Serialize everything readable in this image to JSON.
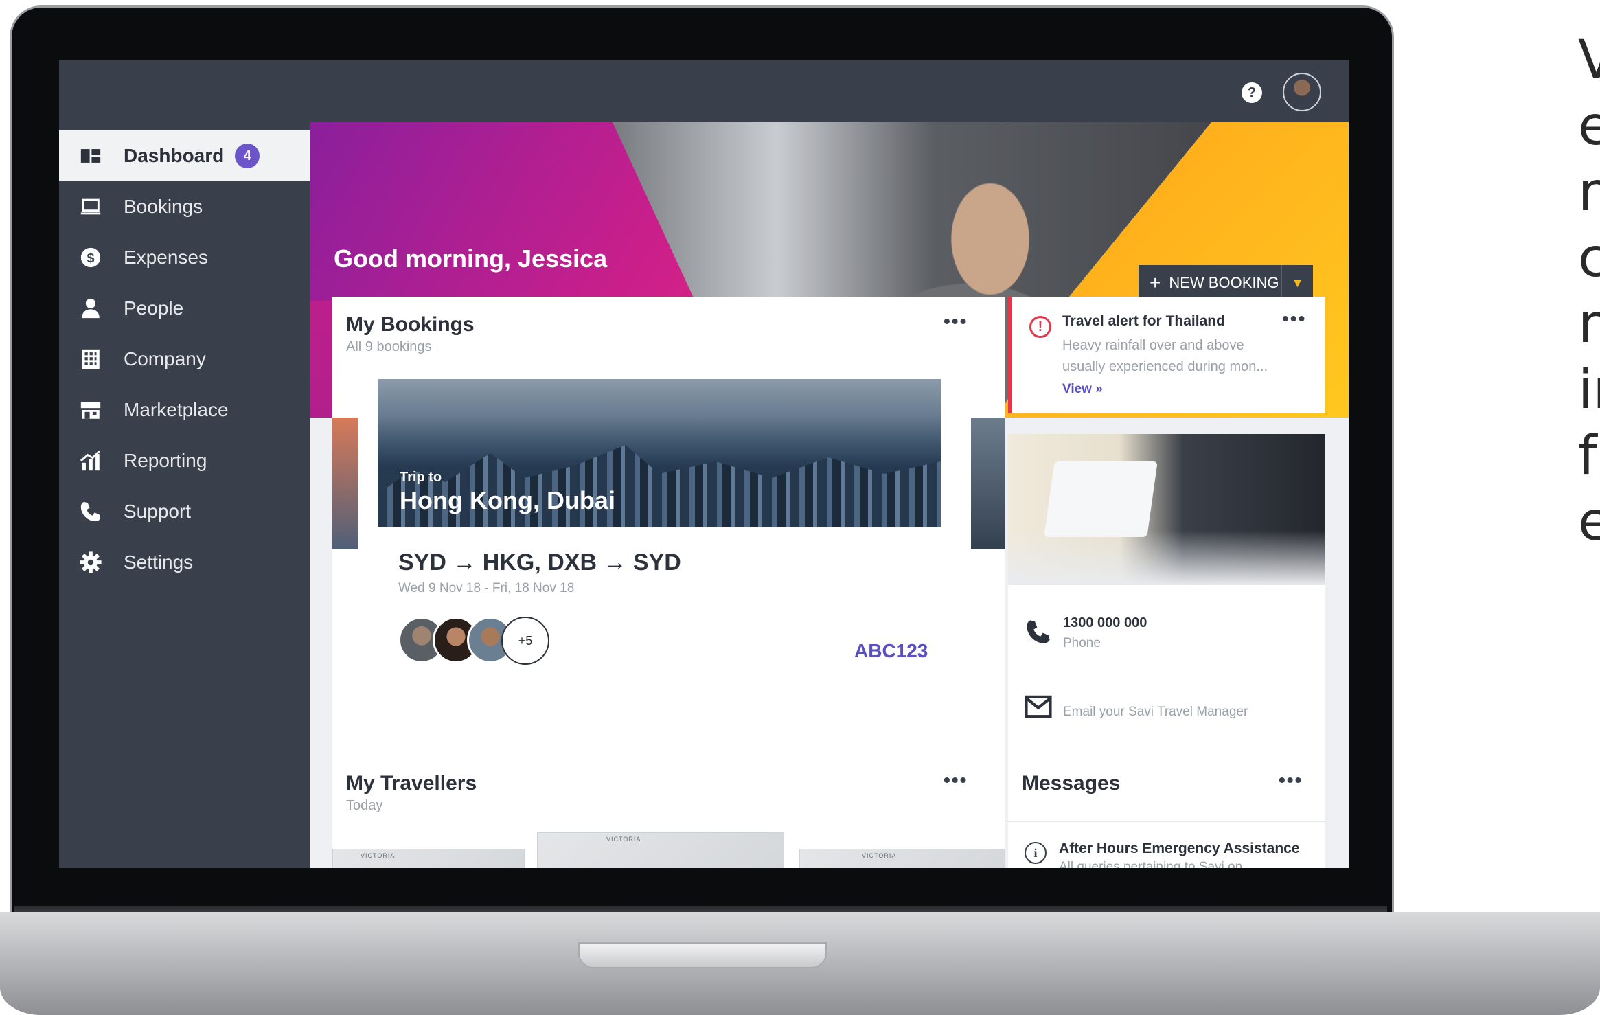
{
  "header": {
    "help_icon": "?",
    "avatar": "user-avatar"
  },
  "sidebar": {
    "items": [
      {
        "label": "Dashboard",
        "icon": "dashboard-icon",
        "active": true,
        "badge": "4"
      },
      {
        "label": "Bookings",
        "icon": "laptop-icon"
      },
      {
        "label": "Expenses",
        "icon": "dollar-icon"
      },
      {
        "label": "People",
        "icon": "person-icon"
      },
      {
        "label": "Company",
        "icon": "building-icon"
      },
      {
        "label": "Marketplace",
        "icon": "store-icon"
      },
      {
        "label": "Reporting",
        "icon": "chart-icon"
      },
      {
        "label": "Support",
        "icon": "phone-icon"
      },
      {
        "label": "Settings",
        "icon": "gear-icon"
      }
    ]
  },
  "hero": {
    "greeting": "Good morning, Jessica",
    "new_booking_label": "NEW BOOKING",
    "new_booking_plus": "+"
  },
  "bookings": {
    "title": "My Bookings",
    "subtitle": "All 9 bookings",
    "more": "•••",
    "trip_label": "Trip to",
    "trip_destination": "Hong Kong, Dubai",
    "route": "SYD → HKG, DXB → SYD",
    "dates": "Wed 9 Nov 18 - Fri, 18 Nov 18",
    "more_travellers": "+5",
    "reference": "ABC123",
    "carousel_pages": 5,
    "carousel_active": 0
  },
  "alert": {
    "title": "Travel alert for Thailand",
    "body_line1": "Heavy rainfall over and above",
    "body_line2": "usually experienced during mon...",
    "link": "View »",
    "more": "•••"
  },
  "contact": {
    "phone_number": "1300 000 000",
    "phone_label": "Phone",
    "email_label": "Email your Savi Travel Manager"
  },
  "travellers": {
    "title": "My Travellers",
    "subtitle": "Today",
    "more": "•••",
    "map_label": "VICTORIA"
  },
  "messages": {
    "title": "Messages",
    "more": "•••",
    "item_title": "After Hours Emergency Assistance",
    "item_body": "All queries pertaining to Savi on"
  },
  "side_text": [
    "V",
    "e",
    "r",
    "c",
    "n",
    "ir",
    "f",
    "e"
  ],
  "colors": {
    "sidebar": "#3a3f4c",
    "accent_purple": "#6c55c9",
    "alert_red": "#e5374a",
    "link_purple": "#5a4fbf",
    "hero_pink": "#cc1f8a",
    "hero_orange": "#ff9b1a"
  }
}
